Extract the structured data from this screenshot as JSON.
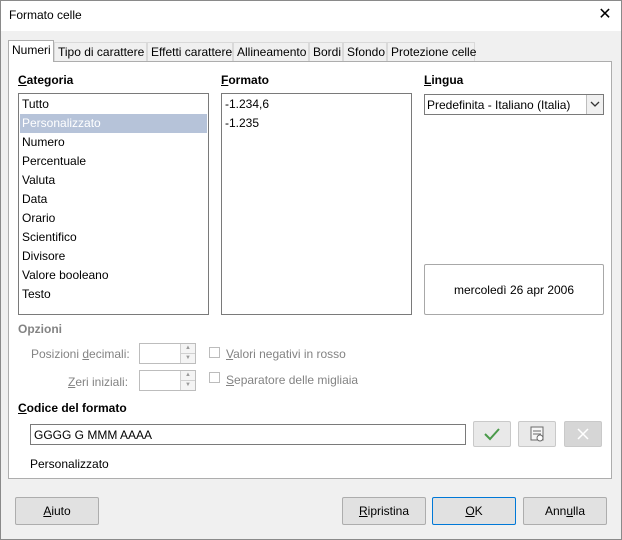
{
  "window": {
    "title": "Formato celle",
    "close_icon": "close-icon"
  },
  "tabs": [
    {
      "label": "Numeri",
      "active": true
    },
    {
      "label": "Tipo di carattere",
      "active": false
    },
    {
      "label": "Effetti carattere",
      "active": false
    },
    {
      "label": "Allineamento",
      "active": false
    },
    {
      "label": "Bordi",
      "active": false
    },
    {
      "label": "Sfondo",
      "active": false
    },
    {
      "label": "Protezione celle",
      "active": false
    }
  ],
  "category": {
    "label_pre": "",
    "label_key": "C",
    "label_post": "ategoria",
    "items": [
      "Tutto",
      "Personalizzato",
      "Numero",
      "Percentuale",
      "Valuta",
      "Data",
      "Orario",
      "Scientifico",
      "Divisore",
      "Valore booleano",
      "Testo"
    ],
    "selected": "Personalizzato"
  },
  "format": {
    "label_pre": "",
    "label_key": "F",
    "label_post": "ormato",
    "items": [
      "-1.234,6",
      "-1.235"
    ]
  },
  "language": {
    "label_pre": "",
    "label_key": "L",
    "label_post": "ingua",
    "selected": "Predefinita - Italiano (Italia)"
  },
  "preview": {
    "text": "mercoledì 26 apr 2006"
  },
  "options": {
    "heading": "Opzioni",
    "decimal_label_pre": "Posizioni ",
    "decimal_label_key": "d",
    "decimal_label_post": "ecimali:",
    "decimal_value": "",
    "leading_label_pre": "",
    "leading_label_key": "Z",
    "leading_label_post": "eri iniziali:",
    "leading_value": "",
    "negative_red_key": "V",
    "negative_red_rest": "alori negativi in rosso",
    "thousands_key": "S",
    "thousands_rest": "eparatore delle migliaia"
  },
  "format_code": {
    "label_key": "C",
    "label_rest": "odice del formato",
    "value": "GGGG G MMM AAAA",
    "description": "Personalizzato"
  },
  "buttons": {
    "help_key": "A",
    "help_rest": "iuto",
    "reset_key": "R",
    "reset_rest": "ipristina",
    "ok_key": "O",
    "ok_rest": "K",
    "cancel_pre": "Ann",
    "cancel_key": "u",
    "cancel_post": "lla"
  },
  "colors": {
    "accent": "#0078d7",
    "selection": "#b6c3d9",
    "confirm_green": "#4a9a4a"
  }
}
